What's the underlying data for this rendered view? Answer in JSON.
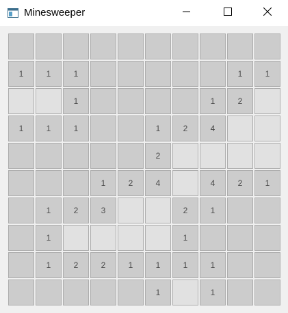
{
  "window": {
    "title": "Minesweeper",
    "icons": {
      "app": "app-window-icon",
      "minimize": "minimize-icon",
      "maximize": "maximize-icon",
      "close": "close-icon"
    }
  },
  "board": {
    "rows": 10,
    "cols": 10,
    "cells": [
      [
        "r",
        "r",
        "r",
        "r",
        "r",
        "r",
        "r",
        "r",
        "r",
        "r"
      ],
      [
        "1",
        "1",
        "1",
        "r",
        "r",
        "r",
        "r",
        "r",
        "1",
        "1"
      ],
      [
        "h",
        "h",
        "1",
        "r",
        "r",
        "r",
        "r",
        "1",
        "2",
        "h"
      ],
      [
        "1",
        "1",
        "1",
        "r",
        "r",
        "1",
        "2",
        "4",
        "h",
        "h"
      ],
      [
        "r",
        "r",
        "r",
        "r",
        "r",
        "2",
        "h",
        "h",
        "h",
        "h"
      ],
      [
        "r",
        "r",
        "r",
        "1",
        "2",
        "4",
        "h",
        "4",
        "2",
        "1"
      ],
      [
        "r",
        "1",
        "2",
        "3",
        "h",
        "h",
        "2",
        "1",
        "r",
        "r"
      ],
      [
        "r",
        "1",
        "h",
        "h",
        "h",
        "h",
        "1",
        "r",
        "r",
        "r"
      ],
      [
        "r",
        "1",
        "2",
        "2",
        "1",
        "1",
        "1",
        "1",
        "r",
        "r"
      ],
      [
        "r",
        "r",
        "r",
        "r",
        "r",
        "1",
        "h",
        "1",
        "r",
        "r"
      ]
    ]
  },
  "colors": {
    "revealed": "#cccccc",
    "hidden": "#e1e1e1",
    "number": "#4a4a4a"
  }
}
